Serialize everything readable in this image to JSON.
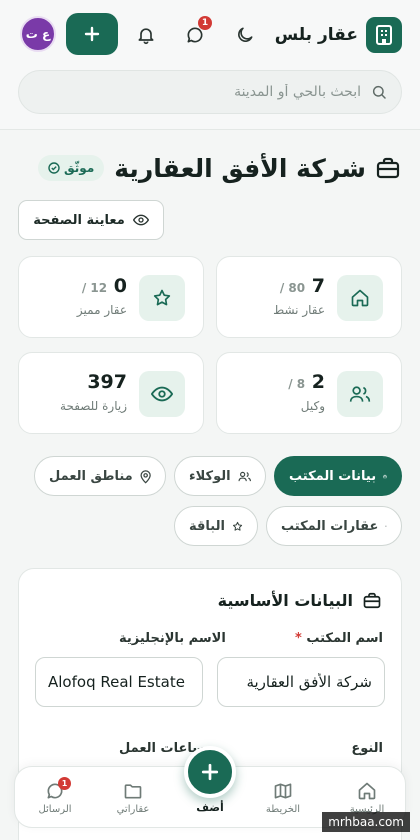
{
  "header": {
    "app_name": "عقار بلس",
    "notification_count": "1",
    "avatar_initials": "ع ت",
    "search_placeholder": "ابحث بالحي أو المدينة"
  },
  "office": {
    "name": "شركة الأفق العقارية",
    "verified_label": "موثّق",
    "preview_label": "معاينة الصفحة"
  },
  "stats": [
    {
      "value": "7",
      "total": "/ 80",
      "label": "عقار نشط",
      "icon": "home-icon"
    },
    {
      "value": "0",
      "total": "/ 12",
      "label": "عقار مميز",
      "icon": "star-icon"
    },
    {
      "value": "2",
      "total": "/ 8",
      "label": "وكيل",
      "icon": "users-icon"
    },
    {
      "value": "397",
      "total": "",
      "label": "زيارة للصفحة",
      "icon": "eye-icon"
    }
  ],
  "tabs": [
    {
      "label": "بيانات المكتب",
      "active": true
    },
    {
      "label": "الوكلاء"
    },
    {
      "label": "مناطق العمل"
    },
    {
      "label": "عقارات المكتب"
    },
    {
      "label": "الباقة"
    }
  ],
  "form": {
    "section_title": "البيانات الأساسية",
    "name_label": "اسم المكتب",
    "name_value": "شركة الأفق العقارية",
    "name_en_label": "الاسم بالإنجليزية",
    "name_en_value": "Alofoq Real Estate",
    "type_label": "النوع",
    "hours_label": "ساعات العمل"
  },
  "bottom_nav": {
    "home": "الرئيسية",
    "map": "الخريطة",
    "add": "أضف",
    "my_properties": "عقاراتي",
    "messages": "الرسائل",
    "messages_badge": "1"
  },
  "watermark": "mrhbaa.com",
  "colors": {
    "primary": "#1a6a55",
    "badge": "#d23a35",
    "avatar": "#7a3aa8"
  }
}
